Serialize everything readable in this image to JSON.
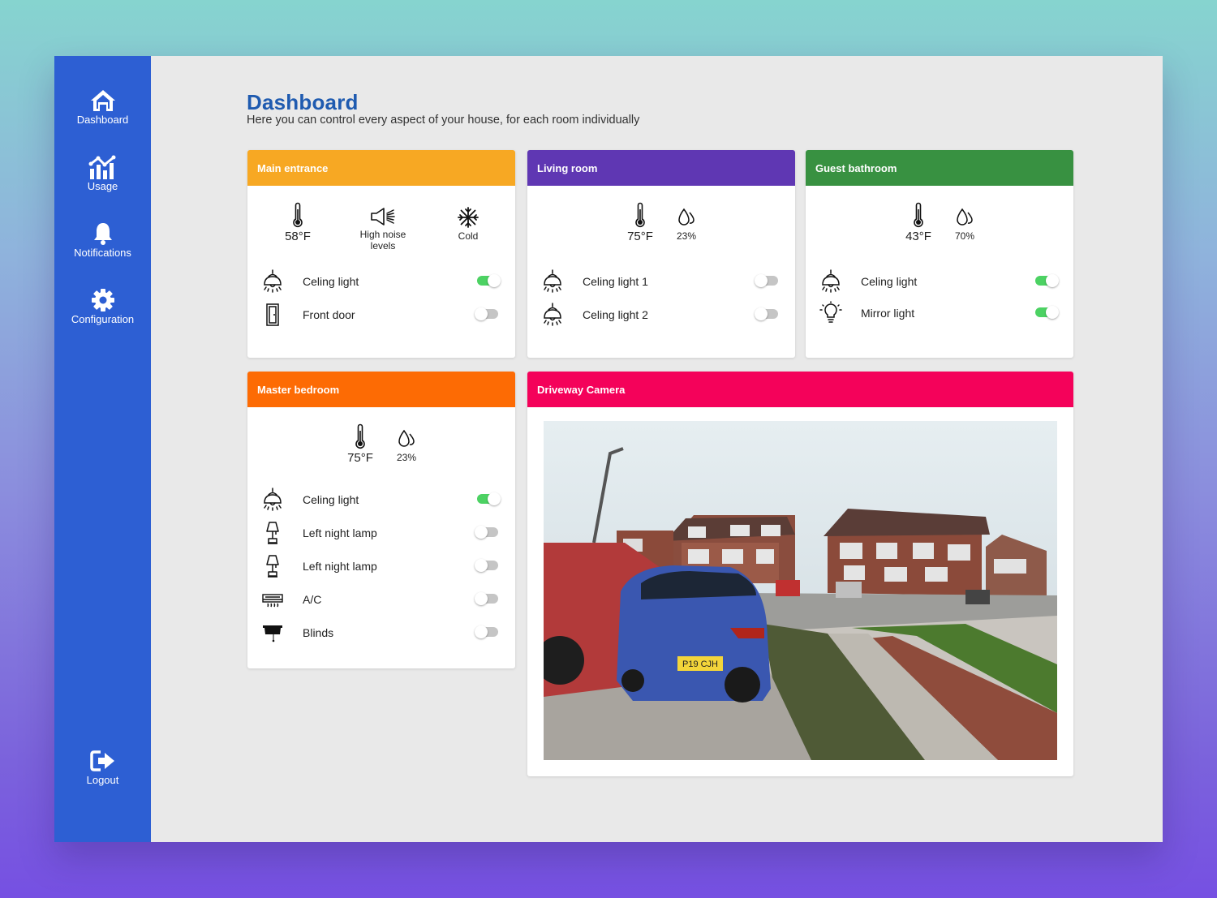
{
  "nav": {
    "items": [
      {
        "label": "Dashboard",
        "icon": "home-icon"
      },
      {
        "label": "Usage",
        "icon": "chart-icon"
      },
      {
        "label": "Notifications",
        "icon": "bell-icon"
      },
      {
        "label": "Configuration",
        "icon": "gear-icon"
      }
    ],
    "logout": {
      "label": "Logout",
      "icon": "logout-icon"
    }
  },
  "page": {
    "title": "Dashboard",
    "subtitle": "Here you can control every aspect of your house, for each room individually"
  },
  "colors": {
    "sidebar": "#2d5fd3",
    "main_entrance": "#f7a823",
    "living_room": "#5f37b3",
    "guest_bathroom": "#389141",
    "master_bedroom": "#fd6b04",
    "camera": "#f4025a",
    "toggle_on": "#4cd263"
  },
  "rooms": {
    "main_entrance": {
      "title": "Main entrance",
      "sensors": [
        {
          "icon": "thermometer-icon",
          "value": "58°F"
        },
        {
          "icon": "megaphone-icon",
          "label": "High noise levels"
        },
        {
          "icon": "snowflake-icon",
          "label": "Cold"
        }
      ],
      "devices": [
        {
          "icon": "ceiling-light-icon",
          "name": "Celing light",
          "on": true
        },
        {
          "icon": "door-icon",
          "name": "Front door",
          "on": false
        }
      ]
    },
    "living_room": {
      "title": "Living room",
      "sensors": [
        {
          "icon": "thermometer-icon",
          "value": "75°F"
        },
        {
          "icon": "humidity-icon",
          "value": "23%"
        }
      ],
      "devices": [
        {
          "icon": "ceiling-light-icon",
          "name": "Celing light 1",
          "on": false
        },
        {
          "icon": "ceiling-light-icon",
          "name": "Celing light 2",
          "on": false
        }
      ]
    },
    "guest_bathroom": {
      "title": "Guest bathroom",
      "sensors": [
        {
          "icon": "thermometer-icon",
          "value": "43°F"
        },
        {
          "icon": "humidity-icon",
          "value": "70%"
        }
      ],
      "devices": [
        {
          "icon": "ceiling-light-icon",
          "name": "Celing light",
          "on": true
        },
        {
          "icon": "bulb-icon",
          "name": "Mirror light",
          "on": true
        }
      ]
    },
    "master_bedroom": {
      "title": "Master bedroom",
      "sensors": [
        {
          "icon": "thermometer-icon",
          "value": "75°F"
        },
        {
          "icon": "humidity-icon",
          "value": "23%"
        }
      ],
      "devices": [
        {
          "icon": "ceiling-light-icon",
          "name": "Celing light",
          "on": true
        },
        {
          "icon": "lamp-icon",
          "name": "Left night lamp",
          "on": false
        },
        {
          "icon": "lamp-icon",
          "name": "Left night lamp",
          "on": false
        },
        {
          "icon": "ac-icon",
          "name": "A/C",
          "on": false
        },
        {
          "icon": "blinds-icon",
          "name": "Blinds",
          "on": false
        }
      ]
    }
  },
  "camera": {
    "title": "Driveway Camera",
    "plate": "P19 CJH"
  }
}
